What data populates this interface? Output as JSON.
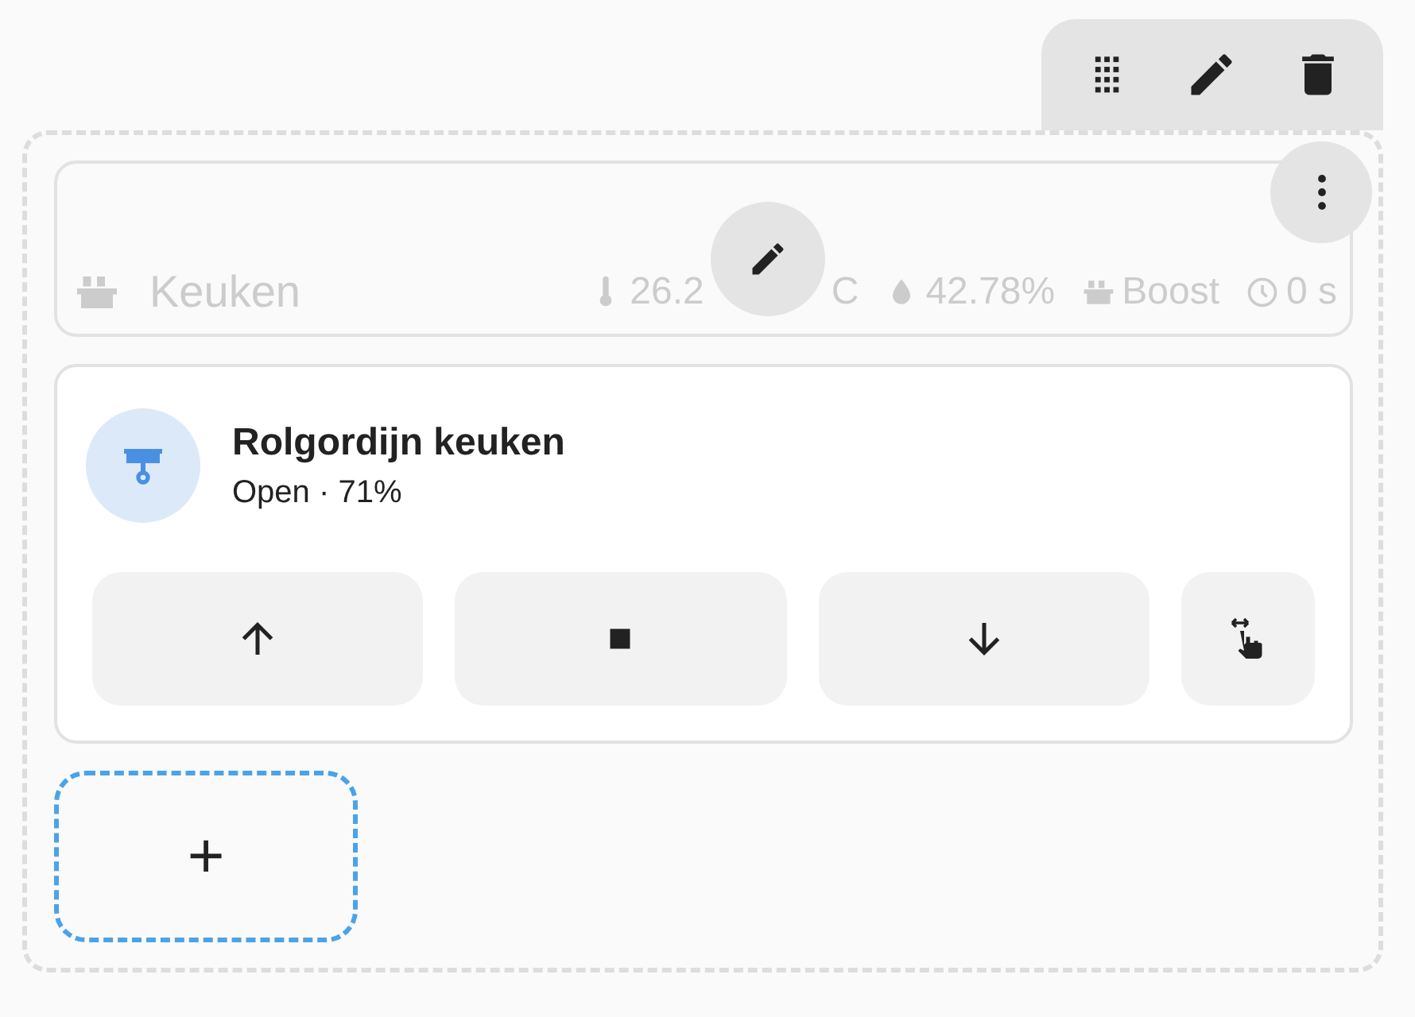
{
  "header_card": {
    "name": "Keuken",
    "temperature_visible_start": "26.2",
    "temperature_visible_end": "C",
    "humidity": "42.78%",
    "preset": "Boost",
    "timer": "0 s"
  },
  "cover_card": {
    "name": "Rolgordijn keuken",
    "state": "Open · 71%",
    "buttons": [
      {
        "kind": "open"
      },
      {
        "kind": "stop"
      },
      {
        "kind": "close"
      },
      {
        "kind": "position"
      }
    ]
  },
  "add_button": {
    "label": "+"
  }
}
